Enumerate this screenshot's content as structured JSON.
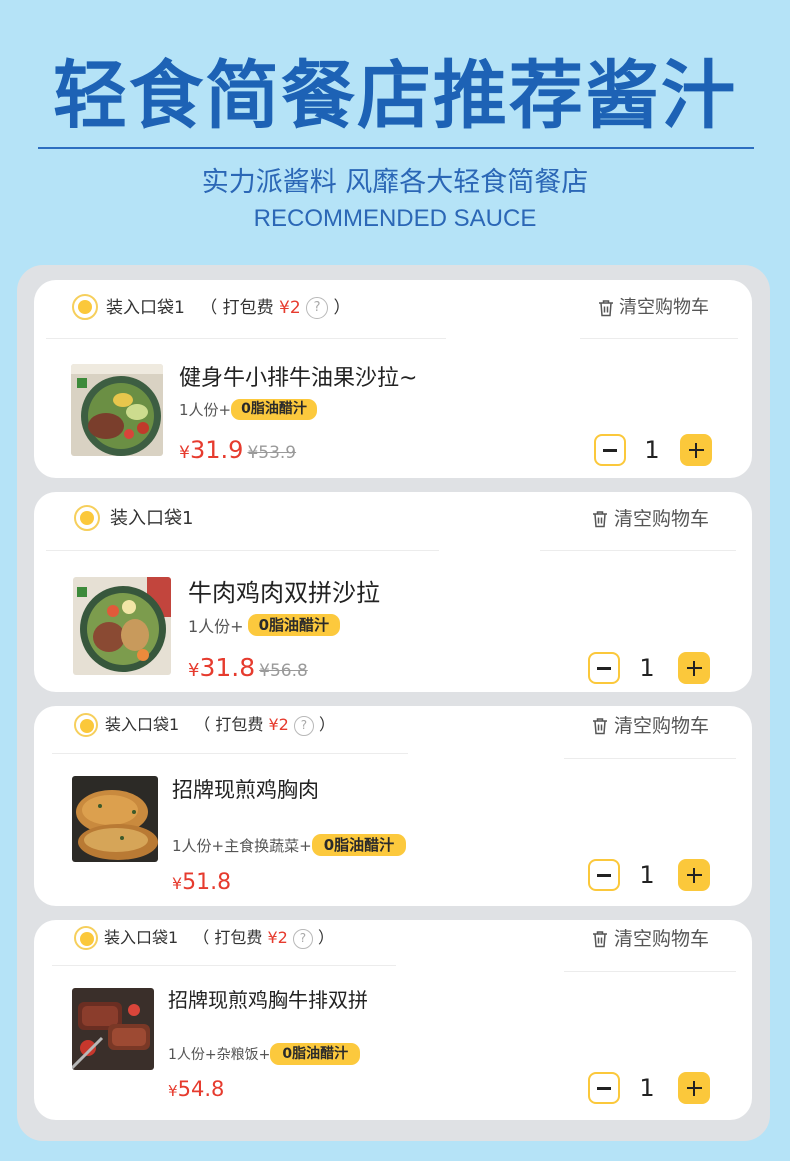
{
  "header": {
    "title": "轻食简餐店推荐酱汁",
    "subtitle": "实力派酱料 风靡各大轻食简餐店",
    "subtitle_en": "RECOMMENDED SAUCE"
  },
  "colors": {
    "brand_blue": "#1d62b5",
    "accent_yellow": "#fbc83b",
    "price_red": "#e63b2e",
    "panel_gray": "#dfe1e4"
  },
  "cards": [
    {
      "bag_label": "装入口袋1",
      "fee_open": "（ 打包费",
      "fee_amount": "¥2",
      "fee_help": "?",
      "fee_close": "）",
      "clear_label": "清空购物车",
      "product_name": "健身牛小排牛油果沙拉~",
      "spec_prefix": "1人份+",
      "sauce_tag": "0脂油醋汁",
      "price_symbol": "¥",
      "price": "31.9",
      "original_price": "¥53.9",
      "quantity": "1"
    },
    {
      "bag_label": "装入口袋1",
      "clear_label": "清空购物车",
      "product_name": "牛肉鸡肉双拼沙拉",
      "spec_prefix": "1人份+",
      "sauce_tag": "0脂油醋汁",
      "price_symbol": "¥",
      "price": "31.8",
      "original_price": "¥56.8",
      "quantity": "1"
    },
    {
      "bag_label": "装入口袋1",
      "fee_open": "（ 打包费",
      "fee_amount": "¥2",
      "fee_help": "?",
      "fee_close": "）",
      "clear_label": "清空购物车",
      "product_name": "招牌现煎鸡胸肉",
      "spec_prefix": "1人份+主食换蔬菜+",
      "sauce_tag": "0脂油醋汁",
      "price_symbol": "¥",
      "price": "51.8",
      "quantity": "1"
    },
    {
      "bag_label": "装入口袋1",
      "fee_open": "（ 打包费",
      "fee_amount": "¥2",
      "fee_help": "?",
      "fee_close": "）",
      "clear_label": "清空购物车",
      "product_name": "招牌现煎鸡胸牛排双拼",
      "spec_prefix": "1人份+杂粮饭+",
      "sauce_tag": "0脂油醋汁",
      "price_symbol": "¥",
      "price": "54.8",
      "quantity": "1"
    }
  ]
}
